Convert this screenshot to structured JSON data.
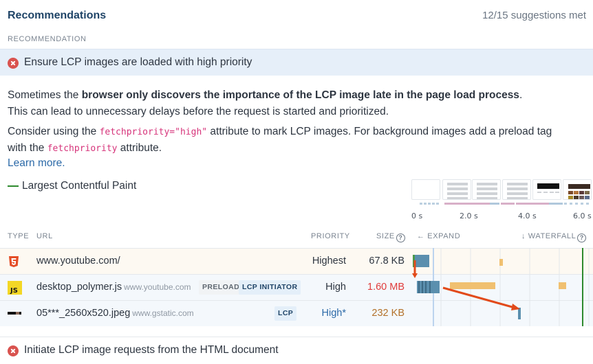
{
  "header": {
    "title": "Recommendations",
    "suggestions_met": "12/15 suggestions met"
  },
  "recommendation_column_label": "RECOMMENDATION",
  "active_recommendation": {
    "status": "failed",
    "icon": "x-circle-icon",
    "title": "Ensure LCP images are loaded with high priority",
    "description": {
      "line1_prefix": "Sometimes the ",
      "line1_bold": "browser only discovers the importance of the LCP image late in the page load process",
      "line1_suffix": ".",
      "line2": "This can lead to unnecessary delays before the request is started and prioritized.",
      "line3_prefix": "Consider using the ",
      "line3_code": "fetchpriority=\"high\"",
      "line3_suffix": " attribute to mark LCP images. For background images add a preload tag",
      "line4_prefix": "with the ",
      "line4_code": "fetchpriority",
      "line4_suffix": " attribute."
    },
    "learn_more": "Learn more."
  },
  "legend": {
    "label": "Largest Contentful Paint",
    "color": "#2e8a2e"
  },
  "timeline": {
    "ticks": [
      "0 s",
      "2.0 s",
      "4.0 s",
      "6.0 s"
    ],
    "max_seconds": 6.2,
    "lcp_seconds": 6.0
  },
  "table": {
    "columns": {
      "type": "TYPE",
      "url": "URL",
      "priority": "PRIORITY",
      "size": "SIZE",
      "expand": "← EXPAND",
      "waterfall": "↓ WATERFALL"
    },
    "rows": [
      {
        "type_icon": "html5-icon",
        "url": "www.youtube.com/",
        "host": "",
        "badges": [],
        "priority": "Highest",
        "priority_color": "#2d3540",
        "size": "67.8 KB",
        "size_color": "#2d3540"
      },
      {
        "type_icon": "javascript-icon",
        "url": "desktop_polymer.js",
        "host": "www.youtube.com",
        "badges": [
          "PRELOAD",
          "LCP INITIATOR"
        ],
        "priority": "High",
        "priority_color": "#2d3540",
        "size": "1.60 MB",
        "size_color": "#e03b3b"
      },
      {
        "type_icon": "image-thumbnail-icon",
        "url": "05***_2560x520.jpeg",
        "host": "www.gstatic.com",
        "badges": [
          "LCP"
        ],
        "priority": "High*",
        "priority_color": "#2c6aa8",
        "size": "232 KB",
        "size_color": "#b3712a"
      }
    ]
  },
  "next_recommendation": {
    "status": "failed",
    "icon": "x-circle-icon",
    "title": "Initiate LCP image requests from the HTML document"
  },
  "colors": {
    "accent_title": "#1f4467",
    "fail": "#d9534f",
    "highlight_bg": "#e6eff9",
    "code": "#d6337a",
    "link": "#2c6aa8",
    "arrow": "#e24a1a",
    "request_bar": "#5b8fae",
    "cpu_bar": "#f0c070"
  }
}
